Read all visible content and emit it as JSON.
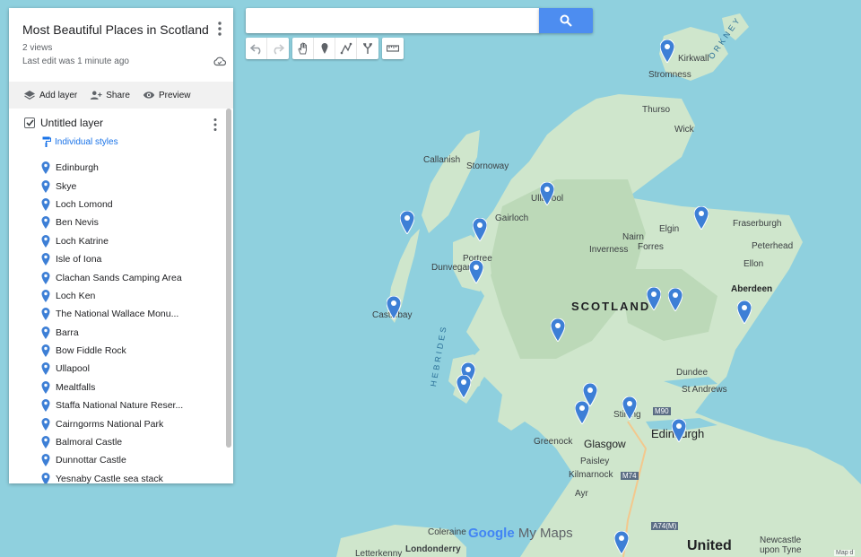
{
  "map": {
    "title": "Most Beautiful Places in Scotland",
    "views": "2 views",
    "last_edit": "Last edit was 1 minute ago",
    "actions": {
      "add_layer": "Add layer",
      "share": "Share",
      "preview": "Preview"
    },
    "layer": {
      "name": "Untitled layer",
      "styles": "Individual styles",
      "places": [
        "Edinburgh",
        "Skye",
        "Loch Lomond",
        "Ben Nevis",
        "Loch Katrine",
        "Isle of Iona",
        "Clachan Sands Camping Area",
        "Loch Ken",
        "The National Wallace Monu...",
        "Barra",
        "Bow Fiddle Rock",
        "Ullapool",
        "Mealtfalls",
        "Staffa National Nature Reser...",
        "Cairngorms National Park",
        "Balmoral Castle",
        "Dunnottar Castle",
        "Yesnaby Castle sea stack"
      ]
    }
  },
  "search": {
    "placeholder": ""
  },
  "map_labels": {
    "kirkwall": "Kirkwall",
    "stromness": "Stromness",
    "orkney": "ORKNEY",
    "thurso": "Thurso",
    "wick": "Wick",
    "callanish": "Callanish",
    "stornoway": "Stornoway",
    "ullapool": "Ullapool",
    "gairloch": "Gairloch",
    "elgin": "Elgin",
    "fraserburgh": "Fraserburgh",
    "peterhead": "Peterhead",
    "nairn": "Nairn",
    "forres": "Forres",
    "inverness": "Inverness",
    "portree": "Portree",
    "dunvegan": "Dunvegan",
    "ellon": "Ellon",
    "aberdeen": "Aberdeen",
    "scotland": "SCOTLAND",
    "castlebay": "Castlebay",
    "hebrides": "HEBRIDES",
    "dundee": "Dundee",
    "st_andrews": "St Andrews",
    "stirling": "Stirling",
    "m90": "M90",
    "edinburgh": "Edinburgh",
    "greenock": "Greenock",
    "glasgow": "Glasgow",
    "paisley": "Paisley",
    "kilmarnock": "Kilmarnock",
    "m74": "M74",
    "ayr": "Ayr",
    "a74m": "A74(M)",
    "coleraine": "Coleraine",
    "londonderry": "Londonderry",
    "letterkenny": "Letterkenny",
    "united": "United",
    "newcastle": "Newcastle upon Tyne",
    "google": "Google",
    "my_maps": "My Maps",
    "map_data": "Map d"
  },
  "colors": {
    "water": "#8fd0de",
    "land": "#cfe6cc",
    "land_high": "#bcd9b8",
    "pin": "#3d7fd6",
    "accent": "#1a73e8"
  }
}
